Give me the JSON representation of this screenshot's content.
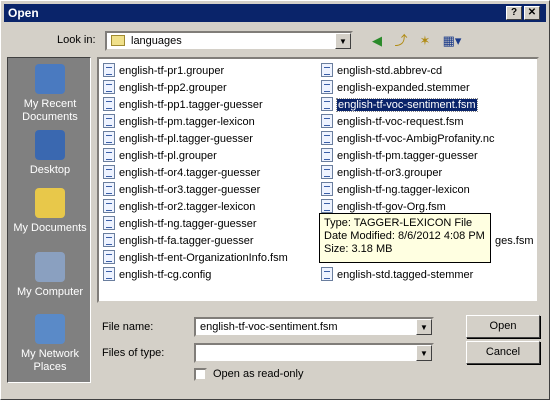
{
  "dialog": {
    "title": "Open"
  },
  "lookin": {
    "label": "Look in:",
    "value": "languages"
  },
  "toolbar": {
    "back_icon": "back-arrow-icon",
    "up_icon": "up-folder-icon",
    "new_folder_icon": "new-folder-icon",
    "views_icon": "views-menu-icon"
  },
  "places": [
    {
      "label": "My Recent Documents",
      "icon": "recent-documents-icon"
    },
    {
      "label": "Desktop",
      "icon": "desktop-icon"
    },
    {
      "label": "My Documents",
      "icon": "my-documents-icon"
    },
    {
      "label": "My Computer",
      "icon": "my-computer-icon"
    },
    {
      "label": "My Network Places",
      "icon": "network-places-icon"
    }
  ],
  "files_col1": [
    "english-tf-pr1.grouper",
    "english-tf-pp2.grouper",
    "english-tf-pp1.tagger-guesser",
    "english-tf-pm.tagger-lexicon",
    "english-tf-pl.tagger-guesser",
    "english-tf-pl.grouper",
    "english-tf-or4.tagger-guesser",
    "english-tf-or3.tagger-guesser",
    "english-tf-or2.tagger-lexicon",
    "english-tf-ng.tagger-guesser",
    "english-tf-fa.tagger-guesser",
    "english-tf-ent-OrganizationInfo.fsm",
    "english-tf-cg.config"
  ],
  "files_col2": [
    "english-std.abbrev-cd",
    "english-expanded.stemmer",
    "english-tf-voc-sentiment.fsm",
    "english-tf-voc-request.fsm",
    "english-tf-voc-AmbigProfanity.nc",
    "english-tf-pm.tagger-guesser",
    "english-tf-or3.grouper",
    "english-tf-ng.tagger-lexicon",
    "english-tf-gov-Org.fsm",
    "ges.fsm",
    "",
    "english-std.tagged-stemmer"
  ],
  "tooltip": {
    "line1": "Type: TAGGER-LEXICON File",
    "line2": "Date Modified: 8/6/2012 4:08 PM",
    "line3": "Size: 3.18 MB"
  },
  "filename": {
    "label": "File name:",
    "value": "english-tf-voc-sentiment.fsm"
  },
  "filetype": {
    "label": "Files of type:",
    "value": ""
  },
  "readonly": {
    "label": "Open as read-only"
  },
  "buttons": {
    "open": "Open",
    "cancel": "Cancel"
  },
  "colors": {
    "title_bar": "#0a246a",
    "selection": "#0a246a",
    "tooltip_bg": "#ffffe1",
    "places_bg": "#808080"
  }
}
